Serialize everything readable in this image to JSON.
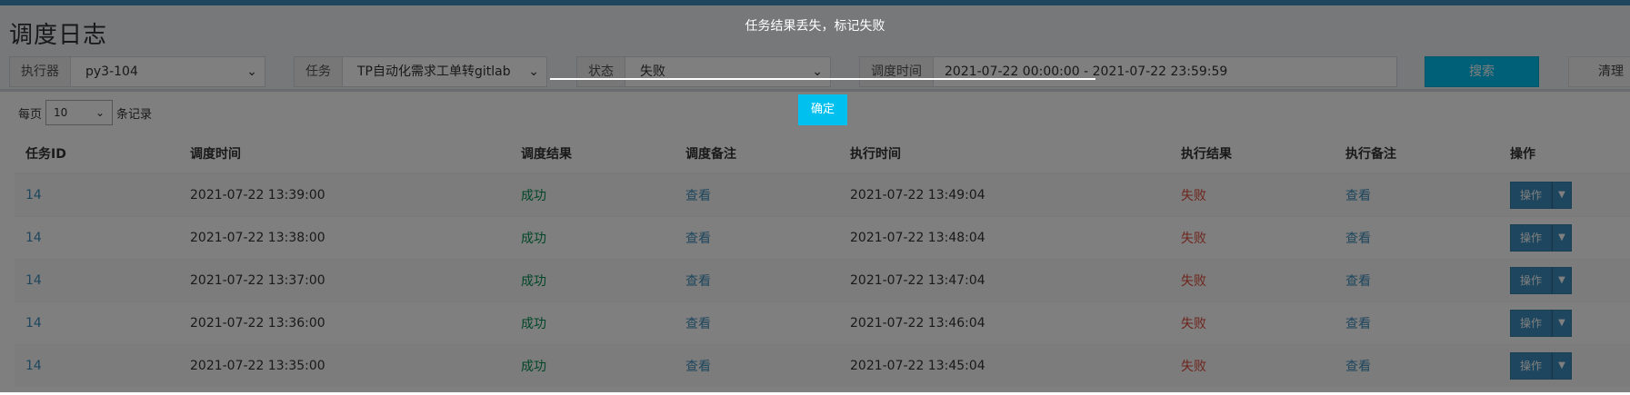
{
  "page": {
    "title": "调度日志"
  },
  "filters": {
    "executor": {
      "label": "执行器",
      "value": "py3-104"
    },
    "job": {
      "label": "任务",
      "value": "TP自动化需求工单转gitlab"
    },
    "status": {
      "label": "状态",
      "value": "失败"
    },
    "time": {
      "label": "调度时间",
      "value": "2021-07-22 00:00:00 - 2021-07-22 23:59:59"
    },
    "search_label": "搜索",
    "clear_label": "清理"
  },
  "page_length": {
    "prefix": "每页",
    "value": "10",
    "suffix": "条记录"
  },
  "table": {
    "headers": [
      "任务ID",
      "调度时间",
      "调度结果",
      "调度备注",
      "执行时间",
      "执行结果",
      "执行备注",
      "操作"
    ],
    "rows": [
      {
        "id": "14",
        "trigger_time": "2021-07-22 13:39:00",
        "trigger_result": "成功",
        "trigger_note": "查看",
        "exec_time": "2021-07-22 13:49:04",
        "exec_result": "失败",
        "exec_note": "查看",
        "action": "操作"
      },
      {
        "id": "14",
        "trigger_time": "2021-07-22 13:38:00",
        "trigger_result": "成功",
        "trigger_note": "查看",
        "exec_time": "2021-07-22 13:48:04",
        "exec_result": "失败",
        "exec_note": "查看",
        "action": "操作"
      },
      {
        "id": "14",
        "trigger_time": "2021-07-22 13:37:00",
        "trigger_result": "成功",
        "trigger_note": "查看",
        "exec_time": "2021-07-22 13:47:04",
        "exec_result": "失败",
        "exec_note": "查看",
        "action": "操作"
      },
      {
        "id": "14",
        "trigger_time": "2021-07-22 13:36:00",
        "trigger_result": "成功",
        "trigger_note": "查看",
        "exec_time": "2021-07-22 13:46:04",
        "exec_result": "失败",
        "exec_note": "查看",
        "action": "操作"
      },
      {
        "id": "14",
        "trigger_time": "2021-07-22 13:35:00",
        "trigger_result": "成功",
        "trigger_note": "查看",
        "exec_time": "2021-07-22 13:45:04",
        "exec_result": "失败",
        "exec_note": "查看",
        "action": "操作"
      }
    ]
  },
  "dialog": {
    "message": "任务结果丢失，标记失败",
    "confirm_label": "确定"
  },
  "icons": {
    "dropdown": "chevron-down-icon",
    "action_caret": "caret-down-icon"
  },
  "colors": {
    "accent": "#3c8dbc",
    "primary_button": "#00c0ef",
    "success": "#008d4c",
    "failure": "#dd4b39"
  }
}
